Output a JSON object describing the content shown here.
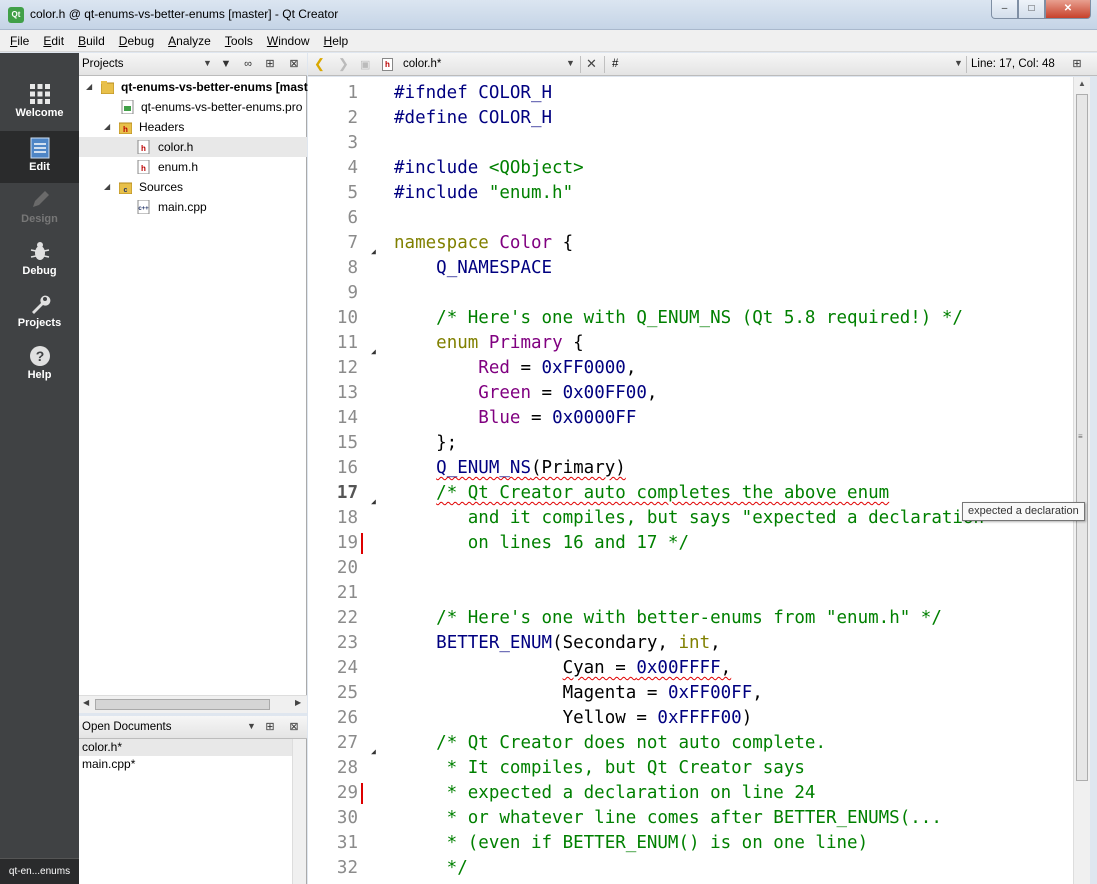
{
  "window": {
    "title": "color.h @ qt-enums-vs-better-enums [master] - Qt Creator",
    "app_icon": "Qt"
  },
  "menu": [
    {
      "u": "F",
      "rest": "ile"
    },
    {
      "u": "E",
      "rest": "dit"
    },
    {
      "u": "B",
      "rest": "uild"
    },
    {
      "u": "D",
      "rest": "ebug"
    },
    {
      "u": "A",
      "rest": "nalyze"
    },
    {
      "u": "T",
      "rest": "ools"
    },
    {
      "u": "W",
      "rest": "indow"
    },
    {
      "u": "H",
      "rest": "elp"
    }
  ],
  "modes": [
    {
      "label": "Welcome",
      "icon": "grid-icon"
    },
    {
      "label": "Edit",
      "icon": "document-icon"
    },
    {
      "label": "Design",
      "icon": "pen-icon"
    },
    {
      "label": "Debug",
      "icon": "bug-icon"
    },
    {
      "label": "Projects",
      "icon": "wrench-icon"
    },
    {
      "label": "Help",
      "icon": "help-icon"
    }
  ],
  "mode_footer": "qt-en...enums",
  "projects_pane": {
    "title": "Projects",
    "tree": [
      {
        "label": "qt-enums-vs-better-enums [master]",
        "bold": true
      },
      {
        "label": "qt-enums-vs-better-enums.pro"
      },
      {
        "label": "Headers"
      },
      {
        "label": "color.h"
      },
      {
        "label": "enum.h"
      },
      {
        "label": "Sources"
      },
      {
        "label": "main.cpp"
      }
    ]
  },
  "open_documents": {
    "title": "Open Documents",
    "items": [
      "color.h*",
      "main.cpp*"
    ]
  },
  "editor_toolbar": {
    "file": "color.h*",
    "symbol": "#",
    "position": "Line: 17, Col: 48"
  },
  "tooltip": "expected a declaration",
  "colors": {
    "preprocessor": "#000080",
    "keyword": "#808000",
    "type": "#800080",
    "comment": "#008000",
    "error_underline": "#e00000"
  },
  "code_lines": [
    {
      "n": "1",
      "parts": [
        [
          "pp",
          "#ifndef COLOR_H"
        ]
      ]
    },
    {
      "n": "2",
      "parts": [
        [
          "pp",
          "#define COLOR_H"
        ]
      ]
    },
    {
      "n": "3",
      "parts": []
    },
    {
      "n": "4",
      "parts": [
        [
          "pp",
          "#include "
        ],
        [
          "str",
          "<QObject>"
        ]
      ]
    },
    {
      "n": "5",
      "parts": [
        [
          "pp",
          "#include "
        ],
        [
          "str",
          "\"enum.h\""
        ]
      ]
    },
    {
      "n": "6",
      "parts": []
    },
    {
      "n": "7",
      "parts": [
        [
          "kw",
          "namespace"
        ],
        [
          "",
          " "
        ],
        [
          "ty",
          "Color"
        ],
        [
          "",
          " {"
        ]
      ]
    },
    {
      "n": "8",
      "parts": [
        [
          "",
          "    "
        ],
        [
          "mac",
          "Q_NAMESPACE"
        ]
      ]
    },
    {
      "n": "9",
      "parts": []
    },
    {
      "n": "10",
      "parts": [
        [
          "",
          "    "
        ],
        [
          "cm",
          "/* Here's one with Q_ENUM_NS (Qt 5.8 required!) */"
        ]
      ]
    },
    {
      "n": "11",
      "parts": [
        [
          "",
          "    "
        ],
        [
          "kw",
          "enum"
        ],
        [
          "",
          " "
        ],
        [
          "ty",
          "Primary"
        ],
        [
          "",
          " {"
        ]
      ]
    },
    {
      "n": "12",
      "parts": [
        [
          "",
          "        "
        ],
        [
          "en",
          "Red"
        ],
        [
          "",
          " = "
        ],
        [
          "num",
          "0xFF0000"
        ],
        [
          "",
          ","
        ]
      ]
    },
    {
      "n": "13",
      "parts": [
        [
          "",
          "        "
        ],
        [
          "en",
          "Green"
        ],
        [
          "",
          " = "
        ],
        [
          "num",
          "0x00FF00"
        ],
        [
          "",
          ","
        ]
      ]
    },
    {
      "n": "14",
      "parts": [
        [
          "",
          "        "
        ],
        [
          "en",
          "Blue"
        ],
        [
          "",
          " = "
        ],
        [
          "num",
          "0x0000FF"
        ]
      ]
    },
    {
      "n": "15",
      "parts": [
        [
          "",
          "    };"
        ]
      ]
    },
    {
      "n": "16",
      "parts": [
        [
          "",
          "    "
        ],
        [
          "mac err",
          "Q_ENUM_NS"
        ],
        [
          "err",
          "(Primary)"
        ]
      ]
    },
    {
      "n": "17",
      "parts": [
        [
          "",
          "    "
        ],
        [
          "cm err",
          "/* Qt Creator auto completes the above enum"
        ]
      ]
    },
    {
      "n": "18",
      "parts": [
        [
          "cm",
          "       and it compiles, but says \"expected a declaration"
        ]
      ]
    },
    {
      "n": "19",
      "parts": [
        [
          "cm",
          "       on lines 16 and 17 */"
        ]
      ]
    },
    {
      "n": "20",
      "parts": []
    },
    {
      "n": "21",
      "parts": []
    },
    {
      "n": "22",
      "parts": [
        [
          "",
          "    "
        ],
        [
          "cm",
          "/* Here's one with better-enums from \"enum.h\" */"
        ]
      ]
    },
    {
      "n": "23",
      "parts": [
        [
          "",
          "    "
        ],
        [
          "mac",
          "BETTER_ENUM"
        ],
        [
          "",
          "(Secondary, "
        ],
        [
          "kw",
          "int"
        ],
        [
          "",
          ","
        ]
      ]
    },
    {
      "n": "24",
      "parts": [
        [
          "",
          "                "
        ],
        [
          "err",
          "Cyan = "
        ],
        [
          "num err",
          "0x00FFFF"
        ],
        [
          "err",
          ","
        ]
      ]
    },
    {
      "n": "25",
      "parts": [
        [
          "",
          "                Magenta = "
        ],
        [
          "num",
          "0xFF00FF"
        ],
        [
          "",
          ","
        ]
      ]
    },
    {
      "n": "26",
      "parts": [
        [
          "",
          "                Yellow = "
        ],
        [
          "num",
          "0xFFFF00"
        ],
        [
          "",
          ")"
        ]
      ]
    },
    {
      "n": "27",
      "parts": [
        [
          "",
          "    "
        ],
        [
          "cm",
          "/* Qt Creator does not auto complete."
        ]
      ]
    },
    {
      "n": "28",
      "parts": [
        [
          "cm",
          "     * It compiles, but Qt Creator says"
        ]
      ]
    },
    {
      "n": "29",
      "parts": [
        [
          "cm",
          "     * expected a declaration on line 24"
        ]
      ]
    },
    {
      "n": "30",
      "parts": [
        [
          "cm",
          "     * or whatever line comes after BETTER_ENUMS(..."
        ]
      ]
    },
    {
      "n": "31",
      "parts": [
        [
          "cm",
          "     * (even if BETTER_ENUM() is on one line)"
        ]
      ]
    },
    {
      "n": "32",
      "parts": [
        [
          "cm",
          "     */"
        ]
      ]
    }
  ]
}
